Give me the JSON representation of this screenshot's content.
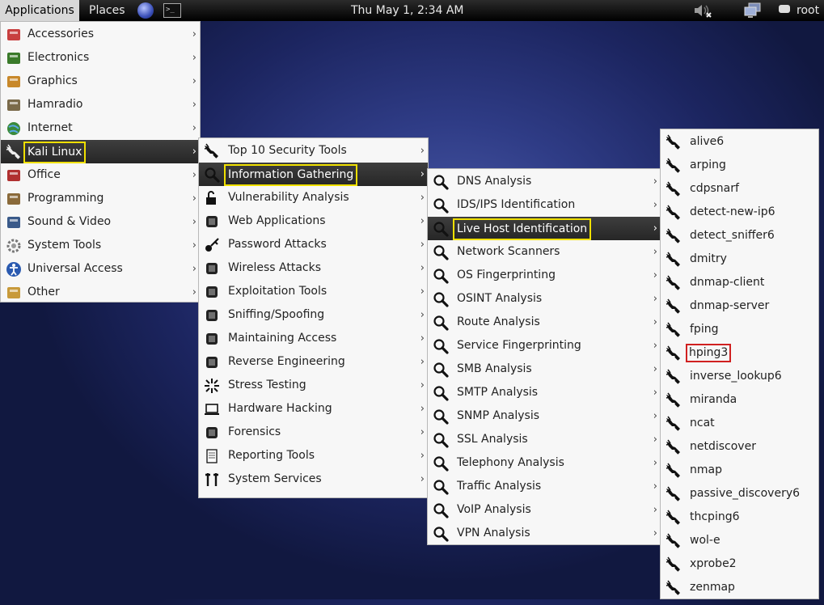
{
  "topbar": {
    "applications": "Applications",
    "places": "Places",
    "clock": "Thu May  1,  2:34 AM",
    "user": "root",
    "icons": [
      "globe-icon",
      "terminal-icon",
      "volume-muted-icon",
      "network-icon",
      "chat-icon"
    ],
    "terminal_glyph": ">_"
  },
  "menu_apps": {
    "items": [
      {
        "label": "Accessories",
        "icon": "accessories-icon"
      },
      {
        "label": "Electronics",
        "icon": "electronics-icon"
      },
      {
        "label": "Graphics",
        "icon": "graphics-icon"
      },
      {
        "label": "Hamradio",
        "icon": "hamradio-icon"
      },
      {
        "label": "Internet",
        "icon": "internet-icon"
      },
      {
        "label": "Kali Linux",
        "icon": "kali-dragon-icon"
      },
      {
        "label": "Office",
        "icon": "office-icon"
      },
      {
        "label": "Programming",
        "icon": "programming-icon"
      },
      {
        "label": "Sound & Video",
        "icon": "sound-video-icon"
      },
      {
        "label": "System Tools",
        "icon": "system-tools-icon"
      },
      {
        "label": "Universal Access",
        "icon": "universal-access-icon"
      },
      {
        "label": "Other",
        "icon": "other-icon"
      }
    ]
  },
  "menu_kali": {
    "items": [
      {
        "label": "Top 10 Security Tools",
        "icon": "kali-dragon-icon"
      },
      {
        "label": "Information Gathering",
        "icon": "magnifier-icon"
      },
      {
        "label": "Vulnerability Analysis",
        "icon": "lock-icon"
      },
      {
        "label": "Web Applications",
        "icon": "web-gears-icon"
      },
      {
        "label": "Password Attacks",
        "icon": "key-icon"
      },
      {
        "label": "Wireless Attacks",
        "icon": "wireless-icon"
      },
      {
        "label": "Exploitation Tools",
        "icon": "exploit-icon"
      },
      {
        "label": "Sniffing/Spoofing",
        "icon": "sniffing-icon"
      },
      {
        "label": "Maintaining Access",
        "icon": "door-icon"
      },
      {
        "label": "Reverse Engineering",
        "icon": "reverse-engineering-icon"
      },
      {
        "label": "Stress Testing",
        "icon": "stress-icon"
      },
      {
        "label": "Hardware Hacking",
        "icon": "laptop-icon"
      },
      {
        "label": "Forensics",
        "icon": "hand-icon"
      },
      {
        "label": "Reporting Tools",
        "icon": "document-icon"
      },
      {
        "label": "System Services",
        "icon": "tools-icon"
      }
    ]
  },
  "menu_info": {
    "items": [
      {
        "label": "DNS Analysis"
      },
      {
        "label": "IDS/IPS Identification"
      },
      {
        "label": "Live Host Identification"
      },
      {
        "label": "Network Scanners"
      },
      {
        "label": "OS Fingerprinting"
      },
      {
        "label": "OSINT Analysis"
      },
      {
        "label": "Route Analysis"
      },
      {
        "label": "Service Fingerprinting"
      },
      {
        "label": "SMB Analysis"
      },
      {
        "label": "SMTP Analysis"
      },
      {
        "label": "SNMP Analysis"
      },
      {
        "label": "SSL Analysis"
      },
      {
        "label": "Telephony Analysis"
      },
      {
        "label": "Traffic Analysis"
      },
      {
        "label": "VoIP Analysis"
      },
      {
        "label": "VPN Analysis"
      }
    ]
  },
  "menu_live": {
    "items": [
      {
        "label": "alive6"
      },
      {
        "label": "arping"
      },
      {
        "label": "cdpsnarf"
      },
      {
        "label": "detect-new-ip6"
      },
      {
        "label": "detect_sniffer6"
      },
      {
        "label": "dmitry"
      },
      {
        "label": "dnmap-client"
      },
      {
        "label": "dnmap-server"
      },
      {
        "label": "fping"
      },
      {
        "label": "hping3"
      },
      {
        "label": "inverse_lookup6"
      },
      {
        "label": "miranda"
      },
      {
        "label": "ncat"
      },
      {
        "label": "netdiscover"
      },
      {
        "label": "nmap"
      },
      {
        "label": "passive_discovery6"
      },
      {
        "label": "thcping6"
      },
      {
        "label": "wol-e"
      },
      {
        "label": "xprobe2"
      },
      {
        "label": "zenmap"
      }
    ]
  },
  "colors": {
    "highlight_yellow": "#f0e000",
    "highlight_red": "#d02020",
    "selected_bg": "#2e2e2e"
  }
}
